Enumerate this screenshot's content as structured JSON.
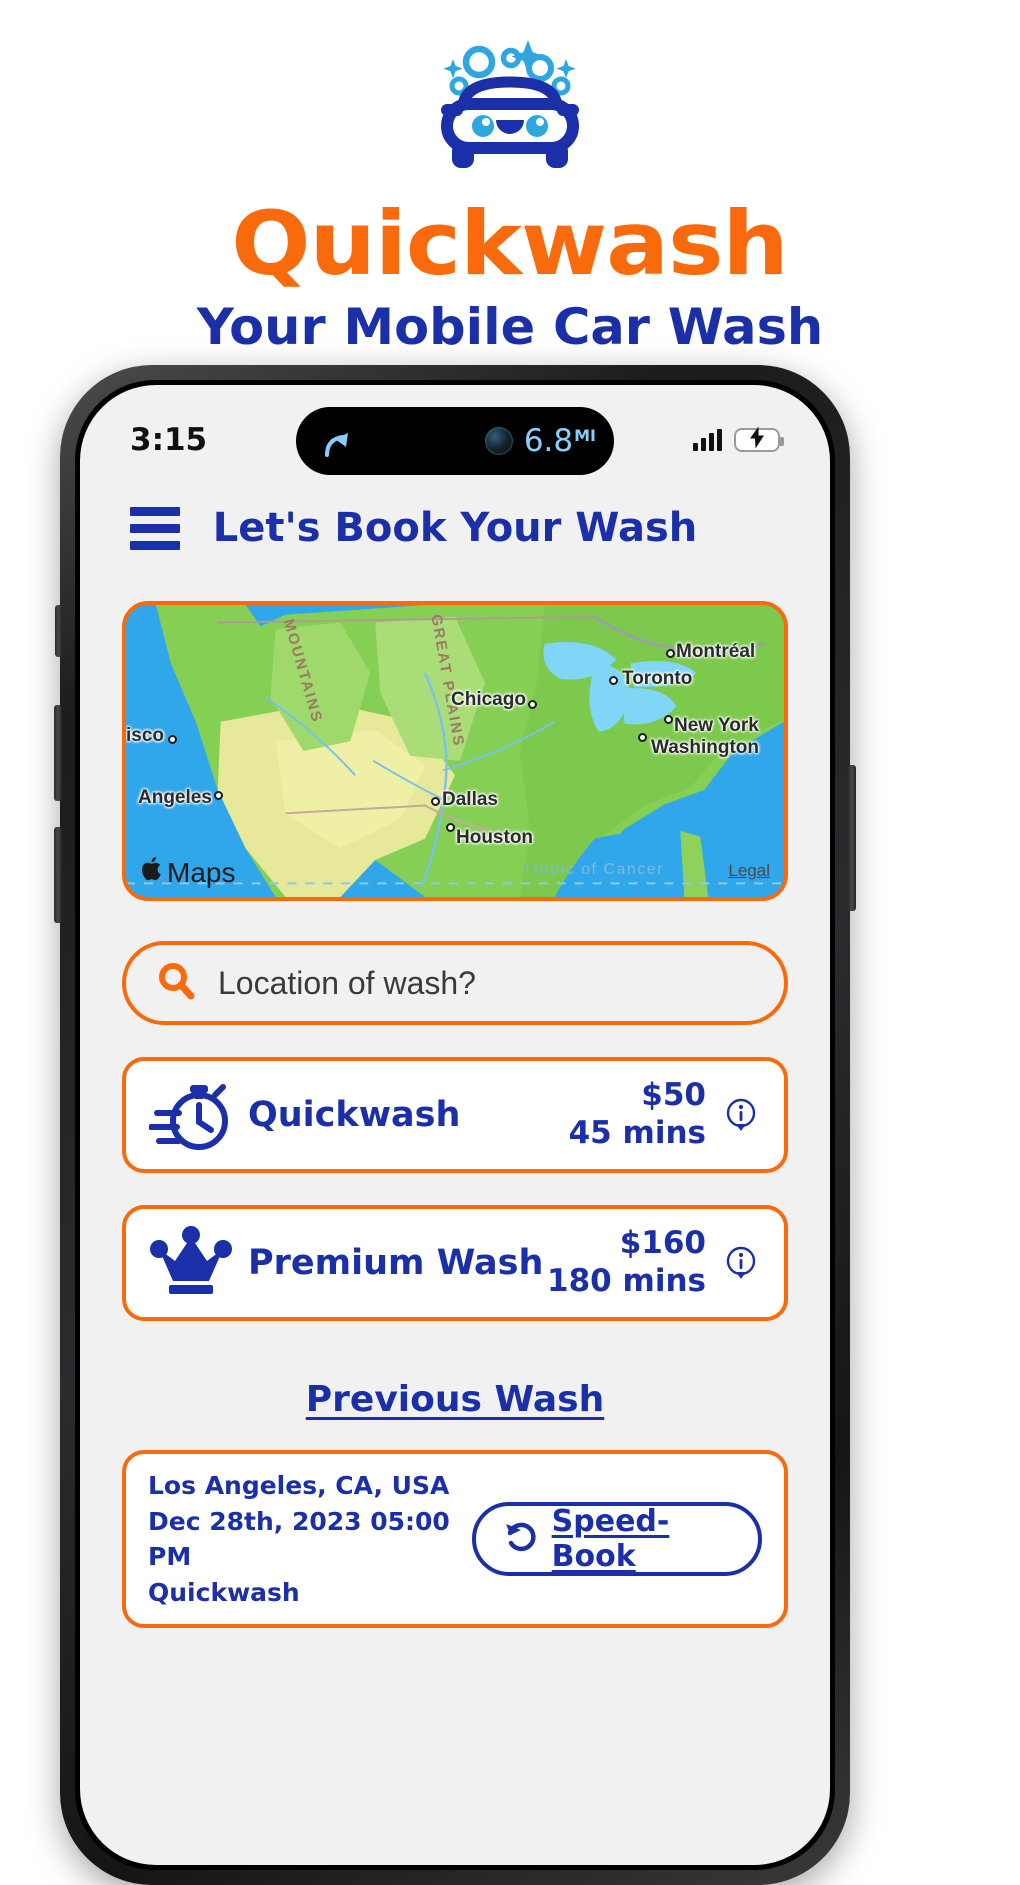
{
  "brand": {
    "logo_icon": "car-wash-logo-icon",
    "title": "Quickwash",
    "tagline": "Your Mobile Car Wash",
    "title_color": "#F96A0C",
    "tagline_color": "#1A2FA8"
  },
  "status_bar": {
    "time": "3:15",
    "dynamic_island": {
      "nav_icon": "navigation-turn-arrow-icon",
      "camera_icon": "front-camera-icon",
      "distance_value": "6.8",
      "distance_unit": "MI"
    },
    "signal_icon": "cellular-signal-icon",
    "signal_bars": 4,
    "battery_icon": "battery-charging-icon",
    "battery_level_pct": 60,
    "battery_charging": true
  },
  "app_header": {
    "menu_icon": "hamburger-menu-icon",
    "title": "Let's Book Your Wash"
  },
  "map": {
    "accent_color": "#F96A0C",
    "attribution": "Maps",
    "attribution_icon": "apple-logo-icon",
    "legal_label": "Legal",
    "tropic_label": "Tropic of Cancer",
    "region_labels": [
      "MOUNTAINS",
      "GREAT PLAINS"
    ],
    "cities": [
      {
        "name": "Montréal"
      },
      {
        "name": "Toronto"
      },
      {
        "name": "Chicago"
      },
      {
        "name": "New York"
      },
      {
        "name": "Washington"
      },
      {
        "name": "Dallas"
      },
      {
        "name": "Houston"
      },
      {
        "name": "Angeles"
      },
      {
        "name": "isco"
      }
    ]
  },
  "search": {
    "icon": "search-icon",
    "placeholder": "Location of wash?",
    "value": ""
  },
  "services": [
    {
      "icon": "stopwatch-icon",
      "name": "Quickwash",
      "price": "$50",
      "duration": "45 mins",
      "info_icon": "info-icon"
    },
    {
      "icon": "crown-icon",
      "name": "Premium Wash",
      "price": "$160",
      "duration": "180 mins",
      "info_icon": "info-icon"
    }
  ],
  "previous_wash": {
    "heading": "Previous Wash",
    "entry": {
      "location": "Los Angeles, CA, USA",
      "datetime": "Dec 28th, 2023 05:00 PM",
      "service": "Quickwash",
      "action_icon": "rebook-refresh-icon",
      "action_label": "Speed-Book"
    }
  }
}
